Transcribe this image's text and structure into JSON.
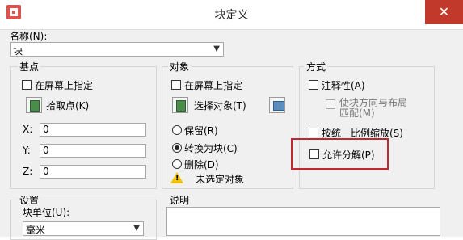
{
  "window": {
    "title": "块定义",
    "close_glyph": "✕"
  },
  "name": {
    "label": "名称(N):",
    "value": "块"
  },
  "base_point": {
    "title": "基点",
    "specify_on_screen": "在屏幕上指定",
    "pick_point": "拾取点(K)",
    "x_label": "X:",
    "x_value": "0",
    "y_label": "Y:",
    "y_value": "0",
    "z_label": "Z:",
    "z_value": "0"
  },
  "objects": {
    "title": "对象",
    "specify_on_screen": "在屏幕上指定",
    "select_objects": "选择对象(T)",
    "retain": "保留(R)",
    "convert_to_block": "转换为块(C)",
    "delete": "删除(D)",
    "selected_state": "未选定对象",
    "selected_option": "convert_to_block"
  },
  "behavior": {
    "title": "方式",
    "annotative": "注释性(A)",
    "match_orientation_line1": "使块方向与布局",
    "match_orientation_line2": "匹配(M)",
    "scale_uniformly": "按统一比例缩放(S)",
    "allow_exploding": "允许分解(P)"
  },
  "settings": {
    "title": "设置",
    "block_unit_label": "块单位(U):",
    "block_unit_value": "毫米"
  },
  "description": {
    "title": "说明"
  },
  "colors": {
    "highlight": "#c4262e",
    "close_button": "#c0392b"
  }
}
